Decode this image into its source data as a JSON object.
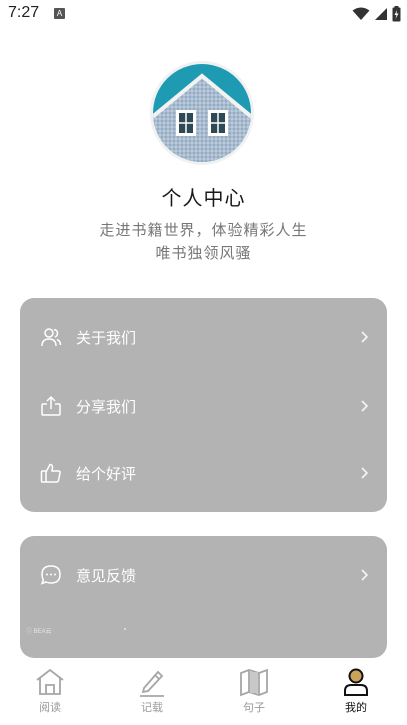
{
  "status": {
    "time": "7:27",
    "notif_letter": "A"
  },
  "profile": {
    "title": "个人中心",
    "subtitle_line1": "走进书籍世界，体验精彩人生",
    "subtitle_line2": "唯书独领风骚"
  },
  "menu_card": {
    "items": [
      {
        "label": "关于我们",
        "icon": "people-icon"
      },
      {
        "label": "分享我们",
        "icon": "share-icon"
      },
      {
        "label": "给个好评",
        "icon": "thumbs-up-icon"
      }
    ]
  },
  "feedback_card": {
    "label": "意见反馈",
    "icon": "chat-icon",
    "mini_text": "ⓘ BEA云"
  },
  "tabs": [
    {
      "label": "阅读",
      "icon": "home-icon",
      "active": false
    },
    {
      "label": "记载",
      "icon": "pen-icon",
      "active": false
    },
    {
      "label": "句子",
      "icon": "map-icon",
      "active": false
    },
    {
      "label": "我的",
      "icon": "user-icon",
      "active": true
    }
  ],
  "colors": {
    "card_bg": "#b3b3b3",
    "active_tab": "#111111",
    "inactive_tab": "#9a9a9a",
    "accent_gold": "#c9a45a"
  }
}
